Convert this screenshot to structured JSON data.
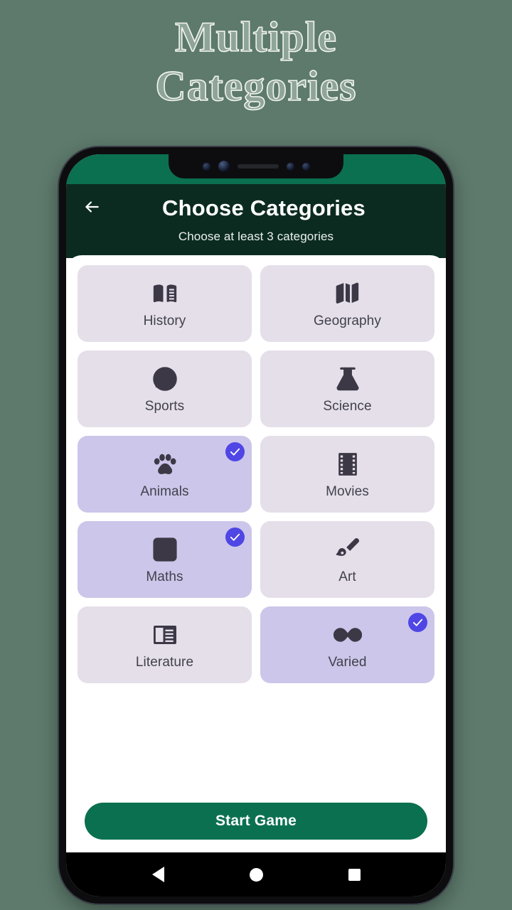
{
  "promo": {
    "line1": "Multiple",
    "line2": "Categories"
  },
  "colors": {
    "page_background": "#5d7a6c",
    "status_bar_green": "#0a7050",
    "appbar_green": "#0c2b20",
    "card_unselected": "#e5dfea",
    "card_selected": "#ccc6ea",
    "check_badge": "#4f46e5",
    "cta_green": "#0a7050",
    "icon_dark": "#3c3846"
  },
  "appbar": {
    "back_icon": "arrow-left-icon",
    "title": "Choose Categories",
    "subtitle": "Choose at least 3 categories"
  },
  "categories": [
    {
      "label": "History",
      "icon": "open-book-icon",
      "selected": false
    },
    {
      "label": "Geography",
      "icon": "map-icon",
      "selected": false
    },
    {
      "label": "Sports",
      "icon": "volleyball-icon",
      "selected": false
    },
    {
      "label": "Science",
      "icon": "flask-icon",
      "selected": false
    },
    {
      "label": "Animals",
      "icon": "paw-print-icon",
      "selected": true
    },
    {
      "label": "Movies",
      "icon": "film-strip-icon",
      "selected": false
    },
    {
      "label": "Maths",
      "icon": "calculator-icon",
      "selected": true
    },
    {
      "label": "Art",
      "icon": "paint-brush-icon",
      "selected": false
    },
    {
      "label": "Literature",
      "icon": "article-icon",
      "selected": false
    },
    {
      "label": "Varied",
      "icon": "infinity-icon",
      "selected": true
    }
  ],
  "cta": {
    "label": "Start Game"
  },
  "navbar": {
    "back": "triangle-back-icon",
    "home": "circle-home-icon",
    "recents": "square-recents-icon"
  },
  "hardware": {
    "volume_up": "volume-up-button",
    "volume_down": "volume-down-button",
    "power": "power-button"
  }
}
